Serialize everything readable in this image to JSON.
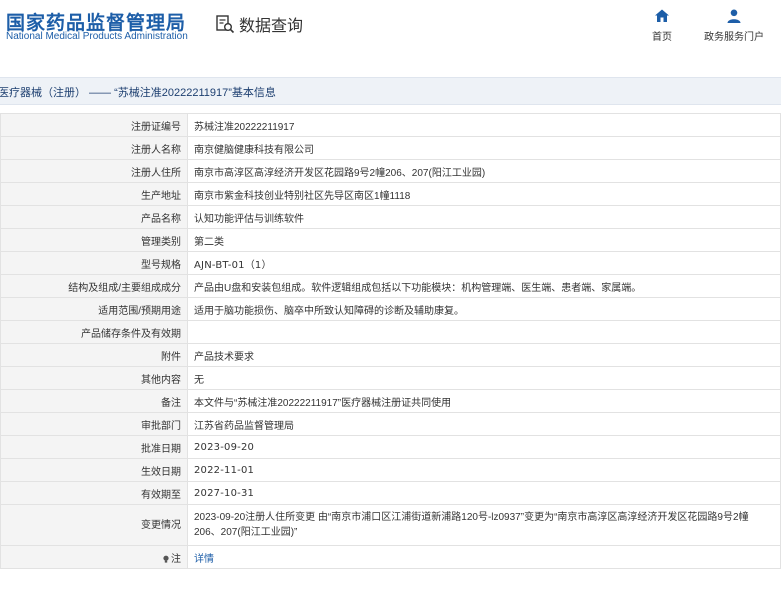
{
  "header": {
    "logo_cn": "国家药品监督管理局",
    "logo_en": "National Medical Products Administration",
    "query_label": "数据查询",
    "nav": [
      {
        "label": "首页",
        "icon": "home-icon"
      },
      {
        "label": "政务服务门户",
        "icon": "user-icon"
      }
    ]
  },
  "title": "医疗器械（注册） —— “苏械注准20222211917”基本信息",
  "rows": [
    {
      "label": "注册证编号",
      "value": "苏械注准20222211917"
    },
    {
      "label": "注册人名称",
      "value": "南京健脑健康科技有限公司"
    },
    {
      "label": "注册人住所",
      "value": "南京市高淳区高淳经济开发区花园路9号2幢206、207(阳江工业园)"
    },
    {
      "label": "生产地址",
      "value": "南京市紫金科技创业特别社区先导区南区1幢1118"
    },
    {
      "label": "产品名称",
      "value": "认知功能评估与训练软件"
    },
    {
      "label": "管理类别",
      "value": "第二类"
    },
    {
      "label": "型号规格",
      "value": "AJN-BT-01（1）"
    },
    {
      "label": "结构及组成/主要组成成分",
      "value": "产品由U盘和安装包组成。软件逻辑组成包括以下功能模块：机构管理端、医生端、患者端、家属端。"
    },
    {
      "label": "适用范围/预期用途",
      "value": "适用于脑功能损伤、脑卒中所致认知障碍的诊断及辅助康复。"
    },
    {
      "label": "产品储存条件及有效期",
      "value": ""
    },
    {
      "label": "附件",
      "value": "产品技术要求"
    },
    {
      "label": "其他内容",
      "value": "无"
    },
    {
      "label": "备注",
      "value": "本文件与“苏械注准20222211917”医疗器械注册证共同使用"
    },
    {
      "label": "审批部门",
      "value": "江苏省药品监督管理局"
    },
    {
      "label": "批准日期",
      "value": "2023-09-20"
    },
    {
      "label": "生效日期",
      "value": "2022-11-01"
    },
    {
      "label": "有效期至",
      "value": "2027-10-31"
    },
    {
      "label": "变更情况",
      "value": "2023-09-20注册人住所变更 由“南京市浦口区江浦街道新浦路120号-lz0937”变更为“南京市高淳区高淳经济开发区花园路9号2幢206、207(阳江工业园)”"
    },
    {
      "label": "注",
      "value": "详情"
    }
  ],
  "colors": {
    "brand": "#1d5ea8",
    "label_bg": "#f4f4f4",
    "titlebar_bg": "#eef2f7"
  }
}
